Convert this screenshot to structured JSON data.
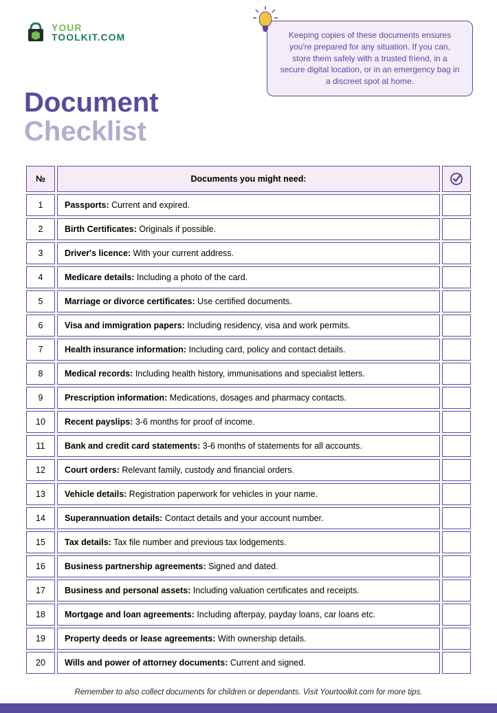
{
  "logo": {
    "line1": "YOUR",
    "line2": "TOOLKIT.COM"
  },
  "callout": "Keeping copies of these documents ensures you're prepared for any situation. If you can, store them safely with a trusted friend, in a secure digital location, or in an emergency bag in a discreet spot at home.",
  "title": {
    "line1": "Document",
    "line2": "Checklist"
  },
  "table": {
    "headers": {
      "num": "№",
      "desc": "Documents you might need:"
    },
    "rows": [
      {
        "n": "1",
        "label": "Passports:",
        "text": " Current and expired."
      },
      {
        "n": "2",
        "label": "Birth Certificates:",
        "text": " Originals if possible."
      },
      {
        "n": "3",
        "label": "Driver's licence:",
        "text": " With your current address."
      },
      {
        "n": "4",
        "label": "Medicare details:",
        "text": " Including a photo of the card."
      },
      {
        "n": "5",
        "label": "Marriage or divorce certificates:",
        "text": " Use certified documents."
      },
      {
        "n": "6",
        "label": "Visa and immigration papers:",
        "text": " Including residency, visa and work permits."
      },
      {
        "n": "7",
        "label": "Health insurance information:",
        "text": "  Including card, policy and contact details."
      },
      {
        "n": "8",
        "label": "Medical records:",
        "text": " Including health history, immunisations and specialist letters."
      },
      {
        "n": "9",
        "label": "Prescription information:",
        "text": " Medications, dosages and pharmacy contacts."
      },
      {
        "n": "10",
        "label": "Recent payslips:",
        "text": " 3-6 months  for proof of income."
      },
      {
        "n": "11",
        "label": "Bank and credit card statements:",
        "text": " 3-6 months of statements for all accounts."
      },
      {
        "n": "12",
        "label": "Court orders:",
        "text": " Relevant family, custody and financial orders."
      },
      {
        "n": "13",
        "label": "Vehicle details:",
        "text": " Registration paperwork for vehicles in your name."
      },
      {
        "n": "14",
        "label": "Superannuation details:",
        "text": " Contact details and your account number."
      },
      {
        "n": "15",
        "label": "Tax details:",
        "text": " Tax file number and previous tax lodgements."
      },
      {
        "n": "16",
        "label": "Business partnership agreements:",
        "text": " Signed and dated."
      },
      {
        "n": "17",
        "label": "Business and personal assets:",
        "text": "  Including valuation certificates and receipts."
      },
      {
        "n": "18",
        "label": "Mortgage and loan agreements:",
        "text": " Including afterpay, payday loans, car loans etc."
      },
      {
        "n": "19",
        "label": "Property deeds or lease agreements:",
        "text": " With ownership details."
      },
      {
        "n": "20",
        "label": "Wills and power of attorney documents:",
        "text": " Current and signed."
      }
    ]
  },
  "footer": "Remember to also collect documents for children or dependants. Visit Yourtoolkit.com for more tips."
}
